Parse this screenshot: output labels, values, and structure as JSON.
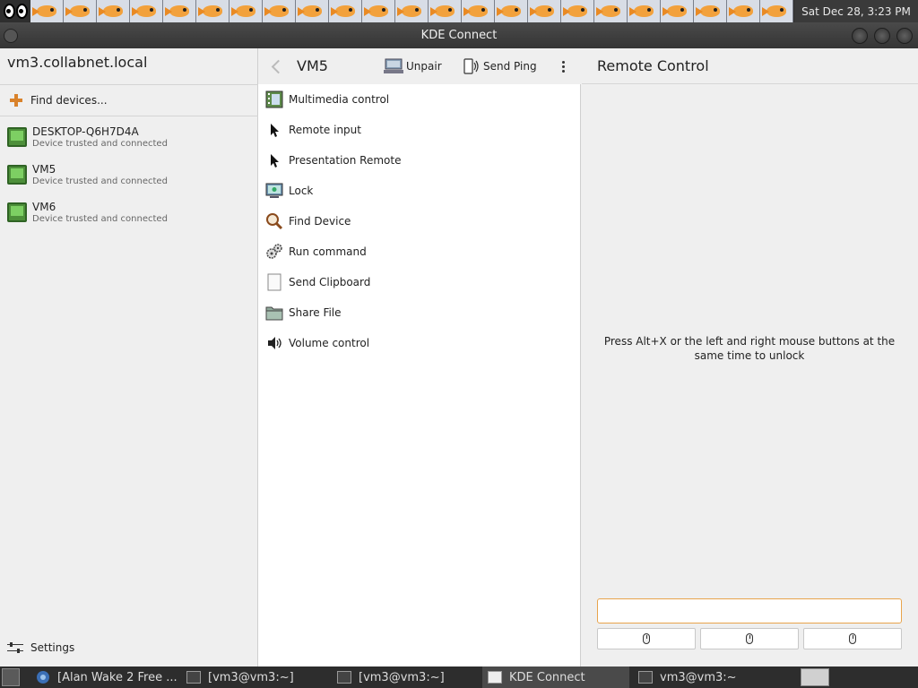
{
  "top_panel": {
    "clock": "Sat Dec 28,  3:23 PM",
    "fish_count": 23
  },
  "window": {
    "title": "KDE Connect"
  },
  "left_pane": {
    "host": "vm3.collabnet.local",
    "find_devices": "Find devices...",
    "devices": [
      {
        "name": "DESKTOP-Q6H7D4A",
        "status": "Device trusted and connected"
      },
      {
        "name": "VM5",
        "status": "Device trusted and connected"
      },
      {
        "name": "VM6",
        "status": "Device trusted and connected"
      }
    ],
    "settings": "Settings"
  },
  "device_header": {
    "title": "VM5",
    "unpair": "Unpair",
    "send_ping": "Send Ping"
  },
  "plugins": [
    {
      "label": "Multimedia control",
      "icon": "film-icon"
    },
    {
      "label": "Remote input",
      "icon": "cursor-icon"
    },
    {
      "label": "Presentation Remote",
      "icon": "cursor-icon"
    },
    {
      "label": "Lock",
      "icon": "lock-screen-icon"
    },
    {
      "label": "Find Device",
      "icon": "magnifier-icon"
    },
    {
      "label": "Run command",
      "icon": "gears-icon"
    },
    {
      "label": "Send Clipboard",
      "icon": "clipboard-icon"
    },
    {
      "label": "Share File",
      "icon": "folder-icon"
    },
    {
      "label": "Volume control",
      "icon": "speaker-icon"
    }
  ],
  "remote_control": {
    "title": "Remote Control",
    "unlock_hint": "Press Alt+X or the left and right mouse buttons at the same time to unlock",
    "input_value": ""
  },
  "taskbar": {
    "tasks": [
      {
        "label": "[Alan Wake 2 Free ..."
      },
      {
        "label": "[vm3@vm3:~]"
      },
      {
        "label": "[vm3@vm3:~]"
      },
      {
        "label": "KDE Connect"
      },
      {
        "label": "vm3@vm3:~"
      }
    ]
  },
  "colors": {
    "accent": "#e8a44c",
    "device_green": "#4d8f3a",
    "panel_bg": "#2e2e2e"
  }
}
